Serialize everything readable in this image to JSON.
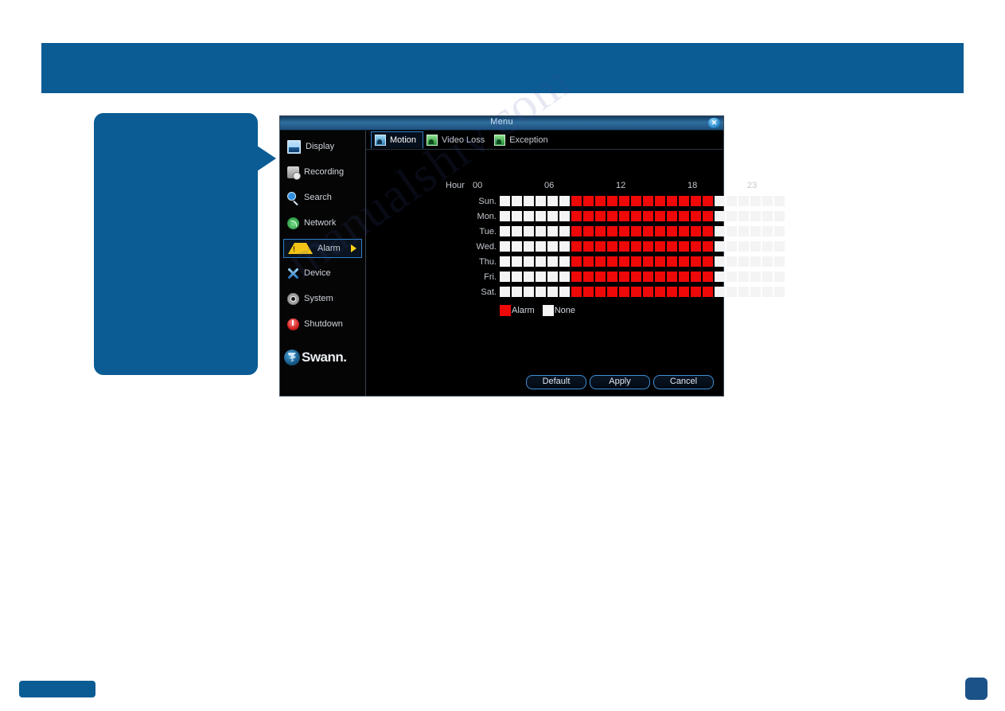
{
  "window": {
    "title": "Menu",
    "close_label": "✕"
  },
  "sidebar": {
    "items": [
      {
        "label": "Display",
        "icon": "display-icon",
        "selected": false
      },
      {
        "label": "Recording",
        "icon": "recording-icon",
        "selected": false
      },
      {
        "label": "Search",
        "icon": "search-icon",
        "selected": false
      },
      {
        "label": "Network",
        "icon": "network-icon",
        "selected": false
      },
      {
        "label": "Alarm",
        "icon": "alarm-icon",
        "selected": true
      },
      {
        "label": "Device",
        "icon": "device-icon",
        "selected": false
      },
      {
        "label": "System",
        "icon": "system-icon",
        "selected": false
      },
      {
        "label": "Shutdown",
        "icon": "shutdown-icon",
        "selected": false
      }
    ],
    "brand": "Swann."
  },
  "tabs": [
    {
      "label": "Motion",
      "icon": "motion-icon",
      "active": true
    },
    {
      "label": "Video Loss",
      "icon": "video-loss-icon",
      "active": false
    },
    {
      "label": "Exception",
      "icon": "exception-icon",
      "active": false
    }
  ],
  "schedule": {
    "hour_header": "Hour",
    "hour_ticks": [
      "00",
      "06",
      "12",
      "18",
      "23"
    ],
    "days": [
      "Sun.",
      "Mon.",
      "Tue.",
      "Wed.",
      "Thu.",
      "Fri.",
      "Sat."
    ],
    "legend": [
      {
        "label": "Alarm",
        "state": "alarm",
        "color": "#ee0808"
      },
      {
        "label": "None",
        "state": "none",
        "color": "#f4f4f4"
      }
    ],
    "rows": [
      {
        "day": "Sun.",
        "cells": [
          "none",
          "none",
          "none",
          "none",
          "none",
          "none",
          "alarm",
          "alarm",
          "alarm",
          "alarm",
          "alarm",
          "alarm",
          "alarm",
          "alarm",
          "alarm",
          "alarm",
          "alarm",
          "alarm",
          "none",
          "none",
          "none",
          "none",
          "none",
          "none"
        ]
      },
      {
        "day": "Mon.",
        "cells": [
          "none",
          "none",
          "none",
          "none",
          "none",
          "none",
          "alarm",
          "alarm",
          "alarm",
          "alarm",
          "alarm",
          "alarm",
          "alarm",
          "alarm",
          "alarm",
          "alarm",
          "alarm",
          "alarm",
          "none",
          "none",
          "none",
          "none",
          "none",
          "none"
        ]
      },
      {
        "day": "Tue.",
        "cells": [
          "none",
          "none",
          "none",
          "none",
          "none",
          "none",
          "alarm",
          "alarm",
          "alarm",
          "alarm",
          "alarm",
          "alarm",
          "alarm",
          "alarm",
          "alarm",
          "alarm",
          "alarm",
          "alarm",
          "none",
          "none",
          "none",
          "none",
          "none",
          "none"
        ]
      },
      {
        "day": "Wed.",
        "cells": [
          "none",
          "none",
          "none",
          "none",
          "none",
          "none",
          "alarm",
          "alarm",
          "alarm",
          "alarm",
          "alarm",
          "alarm",
          "alarm",
          "alarm",
          "alarm",
          "alarm",
          "alarm",
          "alarm",
          "none",
          "none",
          "none",
          "none",
          "none",
          "none"
        ]
      },
      {
        "day": "Thu.",
        "cells": [
          "none",
          "none",
          "none",
          "none",
          "none",
          "none",
          "alarm",
          "alarm",
          "alarm",
          "alarm",
          "alarm",
          "alarm",
          "alarm",
          "alarm",
          "alarm",
          "alarm",
          "alarm",
          "alarm",
          "none",
          "none",
          "none",
          "none",
          "none",
          "none"
        ]
      },
      {
        "day": "Fri.",
        "cells": [
          "none",
          "none",
          "none",
          "none",
          "none",
          "none",
          "alarm",
          "alarm",
          "alarm",
          "alarm",
          "alarm",
          "alarm",
          "alarm",
          "alarm",
          "alarm",
          "alarm",
          "alarm",
          "alarm",
          "none",
          "none",
          "none",
          "none",
          "none",
          "none"
        ]
      },
      {
        "day": "Sat.",
        "cells": [
          "none",
          "none",
          "none",
          "none",
          "none",
          "none",
          "alarm",
          "alarm",
          "alarm",
          "alarm",
          "alarm",
          "alarm",
          "alarm",
          "alarm",
          "alarm",
          "alarm",
          "alarm",
          "alarm",
          "none",
          "none",
          "none",
          "none",
          "none",
          "none"
        ]
      }
    ]
  },
  "buttons": [
    {
      "label": "Default"
    },
    {
      "label": "Apply"
    },
    {
      "label": "Cancel"
    }
  ],
  "watermark": "manualshiv.com",
  "colors": {
    "page_accent": "#0b5c94",
    "alarm": "#ee0808",
    "none": "#f4f4f4",
    "selection_border": "#2f7fc8",
    "arrow": "#ffd21a"
  }
}
